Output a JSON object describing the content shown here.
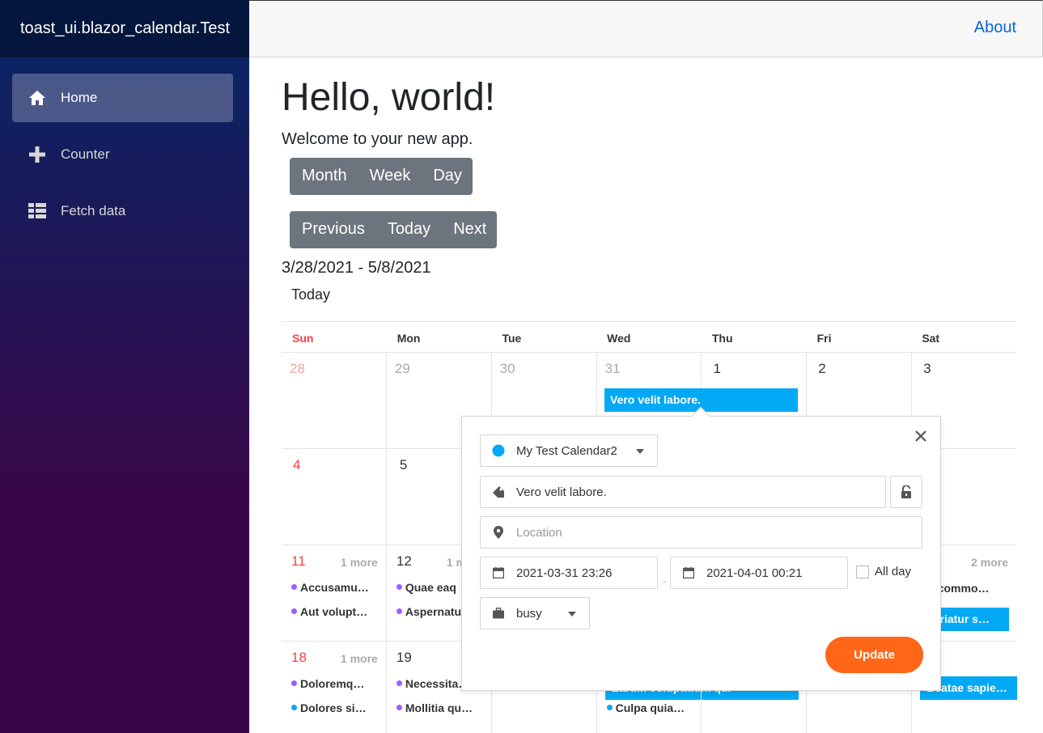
{
  "brand": "toast_ui.blazor_calendar.Test",
  "nav": [
    {
      "label": "Home",
      "icon": "home-icon",
      "active": true
    },
    {
      "label": "Counter",
      "icon": "plus-icon"
    },
    {
      "label": "Fetch data",
      "icon": "list-icon"
    }
  ],
  "top": {
    "about": "About"
  },
  "main": {
    "title": "Hello, world!",
    "welcome": "Welcome to your new app.",
    "view_buttons": [
      "Month",
      "Week",
      "Day"
    ],
    "nav_buttons": [
      "Previous",
      "Today",
      "Next"
    ],
    "range": "3/28/2021 - 5/8/2021",
    "today_label": "Today"
  },
  "calendar": {
    "weekdays": [
      "Sun",
      "Mon",
      "Tue",
      "Wed",
      "Thu",
      "Fri",
      "Sat"
    ],
    "weeks": [
      {
        "days": [
          "28",
          "29",
          "30",
          "31",
          "1",
          "2",
          "3"
        ]
      },
      {
        "days": [
          "4",
          "5",
          "",
          "",
          "",
          "",
          ""
        ]
      },
      {
        "days": [
          "11",
          "12",
          "",
          "",
          "",
          "",
          ""
        ],
        "more": {
          "sun": "1 more",
          "mon": "1 m",
          "sat": "2 more"
        }
      },
      {
        "days": [
          "18",
          "19",
          "",
          "",
          "",
          "",
          ""
        ],
        "more": {
          "sun": "1 more"
        }
      }
    ],
    "events": {
      "wed_week1_bar": "Vero velit labore.",
      "sun_week3": [
        "Accusamu…",
        "Aut volupt…"
      ],
      "mon_week3": [
        "Quae eaq",
        "Aspernatu"
      ],
      "sat_week3_dot": "t commo…",
      "sat_week3_bar": "pariatur s…",
      "sun_week4": [
        "Doloremq…",
        "Dolores si…"
      ],
      "mon_week4": [
        "Necessita…",
        "Mollitia qu…"
      ],
      "wed_week4_bar": "Earum voluptatum qui",
      "wed_week4_dot": "Culpa quia…",
      "sat_week4_bar": "Beatae sapie…"
    },
    "colors": {
      "purple": "#9e5fff",
      "blue": "#03a9f4"
    }
  },
  "popup": {
    "calendar": "My Test Calendar2",
    "calendar_color": "#03a9f4",
    "title": "Vero velit labore.",
    "location_placeholder": "Location",
    "start": "2021-03-31 23:26",
    "end": "2021-04-01 00:21",
    "allday_label": "All day",
    "state": "busy",
    "update": "Update",
    "dash": "-"
  }
}
